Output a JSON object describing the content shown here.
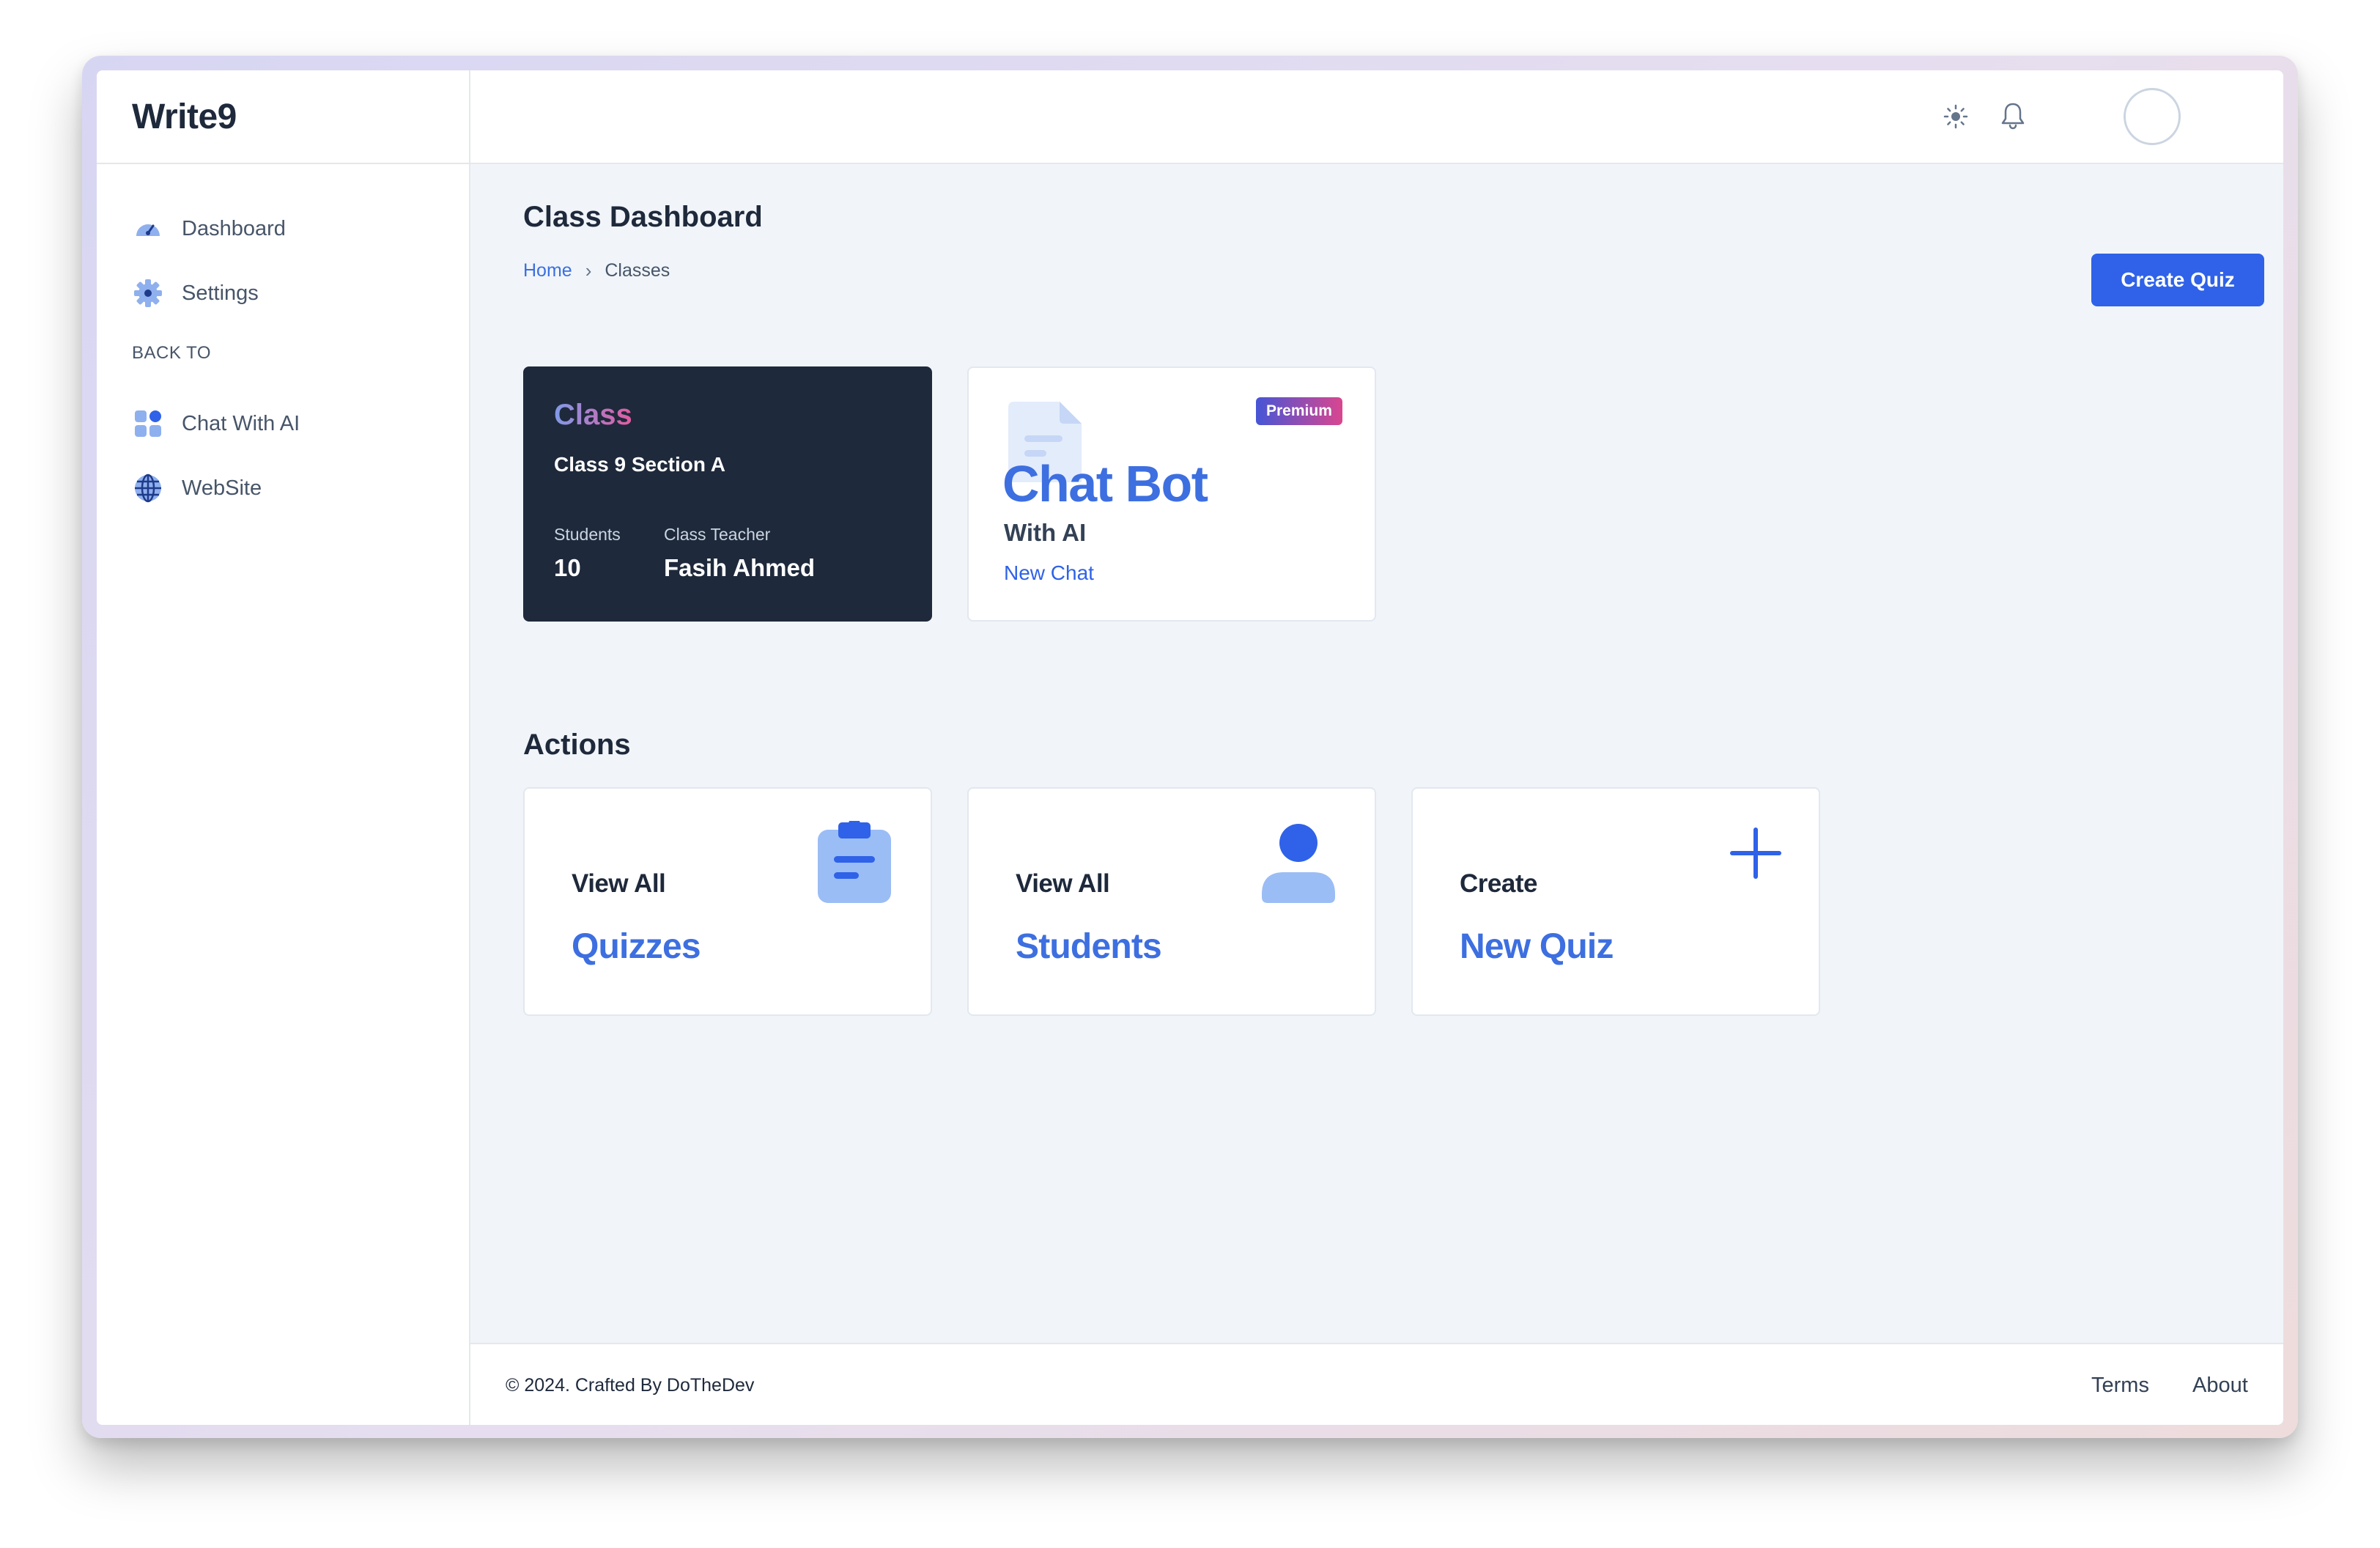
{
  "brand": {
    "title": "Write9"
  },
  "sidebar": {
    "items": [
      {
        "label": "Dashboard",
        "icon": "dashboard-gauge-icon"
      },
      {
        "label": "Settings",
        "icon": "gear-icon"
      }
    ],
    "section_label": "BACK TO",
    "back_items": [
      {
        "label": "Chat With AI",
        "icon": "grid-apps-icon"
      },
      {
        "label": "WebSite",
        "icon": "globe-icon"
      }
    ]
  },
  "header": {
    "icons": [
      "sun-icon",
      "bell-icon",
      "avatar"
    ]
  },
  "page": {
    "title": "Class Dashboard",
    "breadcrumb": {
      "home": "Home",
      "separator": "›",
      "current": "Classes"
    },
    "create_button": "Create Quiz"
  },
  "class_card": {
    "heading": "Class",
    "name": "Class 9 Section A",
    "students_label": "Students",
    "students_value": "10",
    "teacher_label": "Class Teacher",
    "teacher_value": "Fasih Ahmed"
  },
  "chat_card": {
    "badge": "Premium",
    "title": "Chat Bot",
    "subtitle": "With AI",
    "link": "New Chat",
    "icon": "document-icon"
  },
  "actions": {
    "title": "Actions",
    "items": [
      {
        "top": "View All",
        "bottom": "Quizzes",
        "icon": "clipboard-icon"
      },
      {
        "top": "View All",
        "bottom": "Students",
        "icon": "user-icon"
      },
      {
        "top": "Create",
        "bottom": "New Quiz",
        "icon": "plus-icon"
      }
    ]
  },
  "footer": {
    "copyright": "© 2024. Crafted By DoTheDev",
    "links": [
      "Terms",
      "About"
    ]
  },
  "colors": {
    "accent": "#2f62e8",
    "sidebar_bg": "#ffffff",
    "content_bg": "#f1f5f9",
    "dark_card": "#1e293b"
  }
}
